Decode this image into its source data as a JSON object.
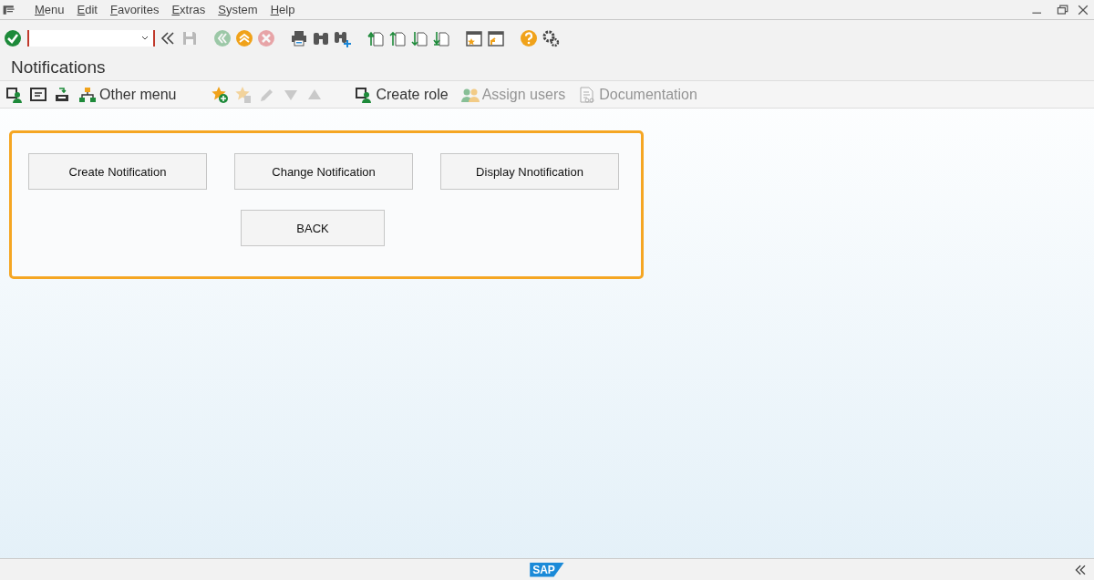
{
  "menu_bar": {
    "items": [
      "Menu",
      "Edit",
      "Favorites",
      "Extras",
      "System",
      "Help"
    ]
  },
  "toolbar": {
    "icons": [
      {
        "kind": "enter",
        "disabled": false
      },
      {
        "kind": "save",
        "disabled": true
      },
      {
        "kind": "back",
        "disabled": true
      },
      {
        "kind": "exit",
        "disabled": false
      },
      {
        "kind": "cancel",
        "disabled": true
      },
      {
        "kind": "print",
        "disabled": false
      },
      {
        "kind": "find",
        "disabled": false
      },
      {
        "kind": "findnext",
        "disabled": false
      },
      {
        "kind": "first",
        "disabled": false
      },
      {
        "kind": "prev",
        "disabled": false
      },
      {
        "kind": "next",
        "disabled": false
      },
      {
        "kind": "last",
        "disabled": false
      },
      {
        "kind": "newsession",
        "disabled": false
      },
      {
        "kind": "shortcut",
        "disabled": false
      },
      {
        "kind": "help",
        "disabled": false
      },
      {
        "kind": "settings",
        "disabled": false
      }
    ]
  },
  "title": "Notifications",
  "app_toolbar": [
    {
      "kind": "usermenu",
      "disabled": false
    },
    {
      "kind": "sapmenu",
      "disabled": false
    },
    {
      "kind": "workplace",
      "disabled": false
    },
    {
      "kind": "othermenu",
      "label": "Other menu",
      "disabled": false
    },
    {
      "kind": "addfav",
      "disabled": false
    },
    {
      "kind": "delfav",
      "disabled": true
    },
    {
      "kind": "edit",
      "disabled": true
    },
    {
      "kind": "down",
      "disabled": true
    },
    {
      "kind": "up",
      "disabled": true
    },
    {
      "kind": "createrole",
      "label": "Create role",
      "disabled": false
    },
    {
      "kind": "assign",
      "label": "Assign users",
      "disabled": true
    },
    {
      "kind": "doc",
      "label": "Documentation",
      "disabled": true
    }
  ],
  "panel": {
    "top_buttons": [
      "Create Notification",
      "Change Notification",
      "Display Nnotification"
    ],
    "bottom_buttons": [
      "BACK"
    ]
  },
  "status_bar": {
    "logo": "SAP"
  }
}
